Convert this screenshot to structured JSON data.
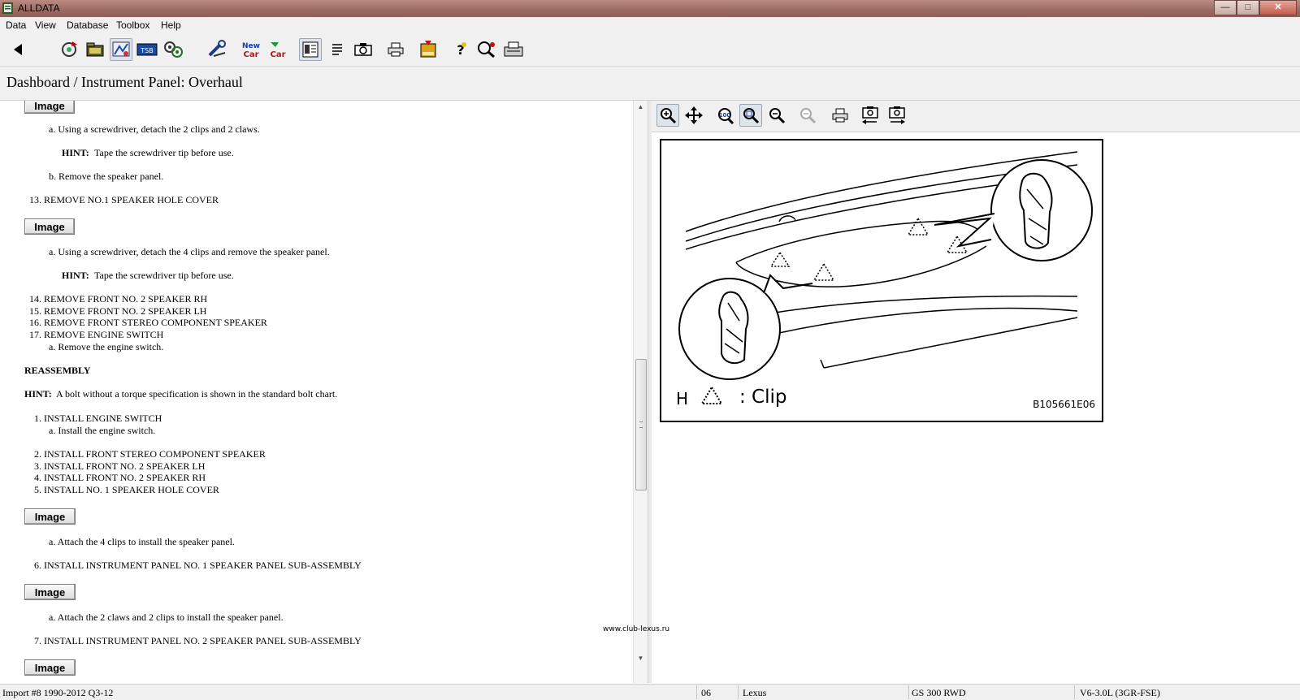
{
  "window": {
    "title": "ALLDATA"
  },
  "menu": {
    "data": "Data",
    "view": "View",
    "database": "Database",
    "toolbox": "Toolbox",
    "help": "Help"
  },
  "toolbar": {
    "icons": [
      "back-arrow-icon",
      "refresh-icon",
      "folder-icon",
      "component-icon",
      "tsb-icon",
      "specs-icon",
      "wrench-icon",
      "new-car-icon",
      "new-car-alt-icon",
      "document-view-icon",
      "text-list-icon",
      "camera-icon",
      "print-icon",
      "note-icon",
      "help-question-icon",
      "search-icon",
      "fax-icon"
    ]
  },
  "breadcrumb": "Dashboard / Instrument Panel:  Overhaul",
  "doc": {
    "image_label": "Image",
    "lines": [
      "a.   Using a screwdriver, detach the 2 clips and 2 claws.",
      "HINT:",
      "Tape the screwdriver tip before use.",
      "b.   Remove the speaker panel.",
      "13.    REMOVE NO.1 SPEAKER HOLE COVER",
      "a.   Using a screwdriver, detach the 4 clips and remove the speaker panel.",
      "HINT:",
      "Tape the screwdriver tip before use.",
      "14.   REMOVE FRONT NO. 2 SPEAKER RH",
      "15.   REMOVE FRONT NO. 2 SPEAKER LH",
      "16.   REMOVE FRONT STEREO COMPONENT SPEAKER",
      "17.   REMOVE ENGINE SWITCH",
      "a.   Remove the engine switch.",
      "REASSEMBLY",
      "HINT:",
      "A bolt without a torque specification is shown in the standard bolt chart.",
      "1.   INSTALL ENGINE SWITCH",
      "a.   Install the engine switch.",
      "2.   INSTALL FRONT STEREO COMPONENT SPEAKER",
      "3.   INSTALL FRONT NO. 2 SPEAKER LH",
      "4.   INSTALL FRONT NO. 2 SPEAKER RH",
      "5.   INSTALL NO. 1 SPEAKER HOLE COVER",
      "a.   Attach the 4 clips to install the speaker panel.",
      "6.   INSTALL INSTRUMENT PANEL NO. 1 SPEAKER PANEL SUB-ASSEMBLY",
      "a.   Attach the 2 claws and 2 clips to install the speaker panel.",
      "7.   INSTALL INSTRUMENT PANEL NO. 2 SPEAKER PANEL SUB-ASSEMBLY"
    ]
  },
  "image_toolbar": {
    "icons": [
      "zoom-in-icon",
      "pan-icon",
      "zoom-100-icon",
      "zoom-fit-icon",
      "zoom-out-icon",
      "zoom-disabled-icon",
      "print-icon",
      "previous-image-icon",
      "next-image-icon"
    ]
  },
  "diagram": {
    "legend_letter": "H",
    "legend_text": ": Clip",
    "code": "B105661E06"
  },
  "watermark": "www.club-lexus.ru",
  "status": {
    "import": "Import #8 1990-2012 Q3-12",
    "year": "06",
    "make": "Lexus",
    "model": "GS 300 RWD",
    "engine": "V6-3.0L (3GR-FSE)"
  }
}
